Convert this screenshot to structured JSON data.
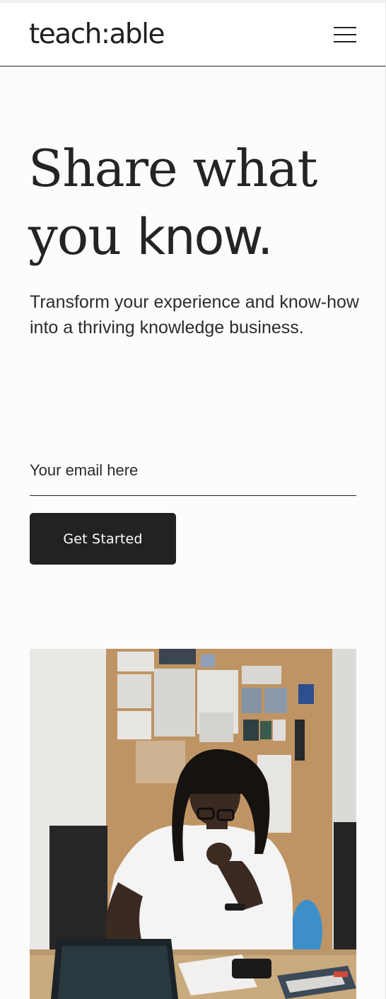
{
  "header": {
    "logo": "teach:able",
    "menu_icon": "hamburger-menu-icon"
  },
  "hero": {
    "headline_line1": "Share what",
    "headline_line2_serif": "you",
    "headline_line2_sans": "know.",
    "subtitle": "Transform your experience and know-how into a thriving knowledge business."
  },
  "signup": {
    "email_placeholder": "Your email here",
    "email_value": "",
    "button_label": "Get Started"
  },
  "photo": {
    "subject": "person-at-desk-photo"
  },
  "colors": {
    "text": "#222222",
    "button_bg": "#222222",
    "button_text": "#ffffff",
    "background": "#ffffff"
  }
}
